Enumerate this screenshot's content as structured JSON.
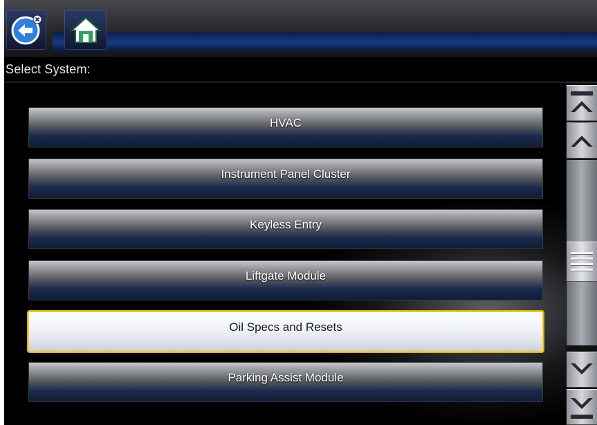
{
  "toolbar": {
    "back_icon": "back-arrow-icon",
    "home_icon": "home-icon"
  },
  "header": {
    "title": "Select System:"
  },
  "systems": [
    {
      "label": "HVAC",
      "selected": false
    },
    {
      "label": "Instrument Panel Cluster",
      "selected": false
    },
    {
      "label": "Keyless Entry",
      "selected": false
    },
    {
      "label": "Liftgate Module",
      "selected": false
    },
    {
      "label": "Oil Specs and Resets",
      "selected": true
    },
    {
      "label": "Parking Assist Module",
      "selected": false
    }
  ],
  "scrollbar": {
    "icons": [
      "scroll-top-icon",
      "scroll-up-icon",
      "scroll-down-icon",
      "scroll-bottom-icon"
    ]
  },
  "colors": {
    "selection_border": "#e0b400",
    "accent_blue": "#2f7fe0"
  }
}
